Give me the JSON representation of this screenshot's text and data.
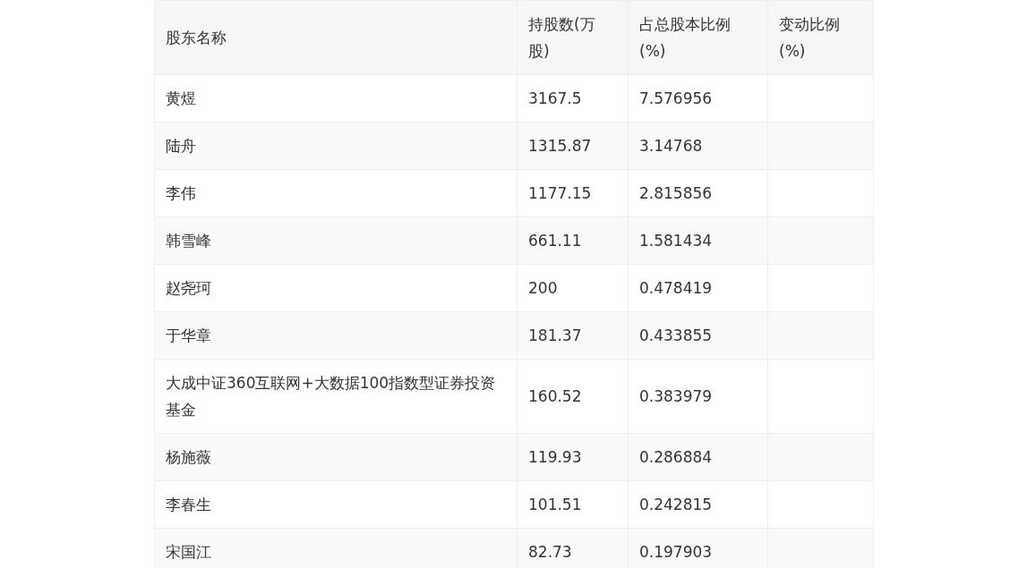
{
  "table": {
    "columns": [
      "股东名称",
      "持股数(万股)",
      "占总股本比例(%)",
      "变动比例(%)"
    ],
    "rows": [
      [
        "黄煜",
        "3167.5",
        "7.576956"
      ],
      [
        "陆舟",
        "1315.87",
        "3.14768"
      ],
      [
        "李伟",
        "1177.15",
        "2.815856"
      ],
      [
        "韩雪峰",
        "661.11",
        "1.581434"
      ],
      [
        "赵尧珂",
        "200",
        "0.478419"
      ],
      [
        "于华章",
        "181.37",
        "0.433855"
      ],
      [
        "大成中证360互联网+大数据100指数型证券投资基金",
        "160.52",
        "0.383979"
      ],
      [
        "杨施薇",
        "119.93",
        "0.286884"
      ],
      [
        "李春生",
        "101.51",
        "0.242815"
      ],
      [
        "宋国江",
        "82.73",
        "0.197903"
      ]
    ]
  }
}
